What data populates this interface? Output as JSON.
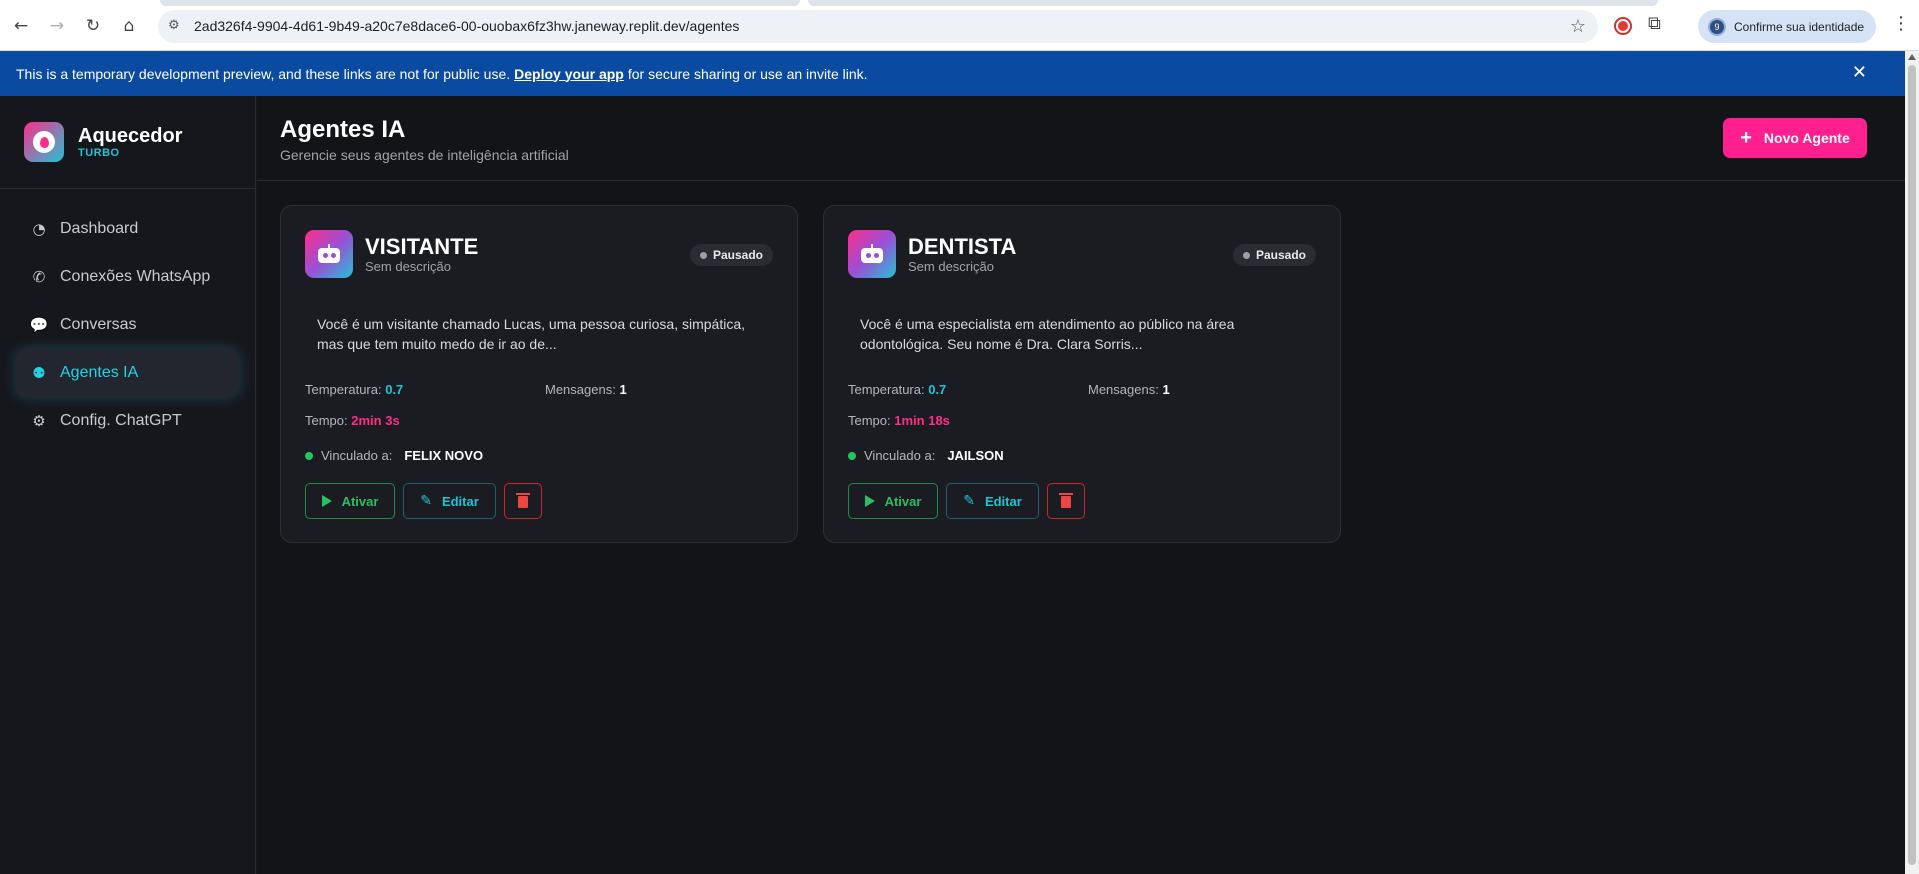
{
  "browser": {
    "url": "2ad326f4-9904-4d61-9b49-a20c7e8dace6-00-ouobax6fz3hw.janeway.replit.dev/agentes",
    "identity_label": "Confirme sua identidade",
    "identity_initial": "9"
  },
  "banner": {
    "text_before": "This is a temporary development preview, and these links are not for public use.",
    "link": "Deploy your app",
    "text_after": "for secure sharing or use an invite link."
  },
  "sidebar": {
    "brand_name": "Aquecedor",
    "brand_sub": "TURBO",
    "items": [
      {
        "label": "Dashboard",
        "icon": "gauge-icon"
      },
      {
        "label": "Conexões WhatsApp",
        "icon": "whatsapp-icon"
      },
      {
        "label": "Conversas",
        "icon": "chat-icon"
      },
      {
        "label": "Agentes IA",
        "icon": "robot-icon",
        "active": true
      },
      {
        "label": "Config. ChatGPT",
        "icon": "gear-icon"
      }
    ]
  },
  "header": {
    "title": "Agentes IA",
    "subtitle": "Gerencie seus agentes de inteligência artificial",
    "new_button": "Novo Agente"
  },
  "agents": [
    {
      "name": "VISITANTE",
      "description": "Sem descrição",
      "status": "Pausado",
      "prompt": "Você é um visitante chamado Lucas, uma pessoa curiosa, simpática, mas que tem muito medo de ir ao de...",
      "temperature_label": "Temperatura:",
      "temperature": "0.7",
      "messages_label": "Mensagens:",
      "messages": "1",
      "time_label": "Tempo:",
      "time": "2min 3s",
      "linked_label": "Vinculado a:",
      "linked_to": "FELIX NOVO",
      "activate_label": "Ativar",
      "edit_label": "Editar"
    },
    {
      "name": "DENTISTA",
      "description": "Sem descrição",
      "status": "Pausado",
      "prompt": "Você é uma especialista em atendimento ao público na área odontológica. Seu nome é Dra. Clara Sorris...",
      "temperature_label": "Temperatura:",
      "temperature": "0.7",
      "messages_label": "Mensagens:",
      "messages": "1",
      "time_label": "Tempo:",
      "time": "1min 18s",
      "linked_label": "Vinculado a:",
      "linked_to": "JAILSON",
      "activate_label": "Ativar",
      "edit_label": "Editar"
    }
  ],
  "colors": {
    "accent_pink": "#ff1f8e",
    "accent_cyan": "#22c3d6",
    "success_green": "#22c55e",
    "danger_red": "#ef4444",
    "banner_blue": "#0a4aa0"
  }
}
